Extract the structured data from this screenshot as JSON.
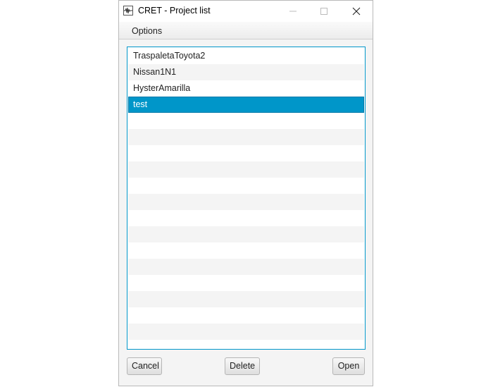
{
  "window": {
    "title": "CRET - Project list",
    "icon": "waveform-icon",
    "controls": {
      "minimize": "─",
      "maximize": "☐",
      "close": "✕"
    }
  },
  "menu": {
    "options_label": "Options"
  },
  "projects": {
    "items": [
      "TraspaletaToyota2",
      "Nissan1N1",
      "HysterAmarilla",
      "test"
    ],
    "selected_index": 3
  },
  "buttons": {
    "cancel_label": "Cancel",
    "delete_label": "Delete",
    "open_label": "Open"
  },
  "colors": {
    "accent": "#0096c9",
    "row_alt": "#f4f4f4",
    "window_bg": "#f4f4f4"
  }
}
